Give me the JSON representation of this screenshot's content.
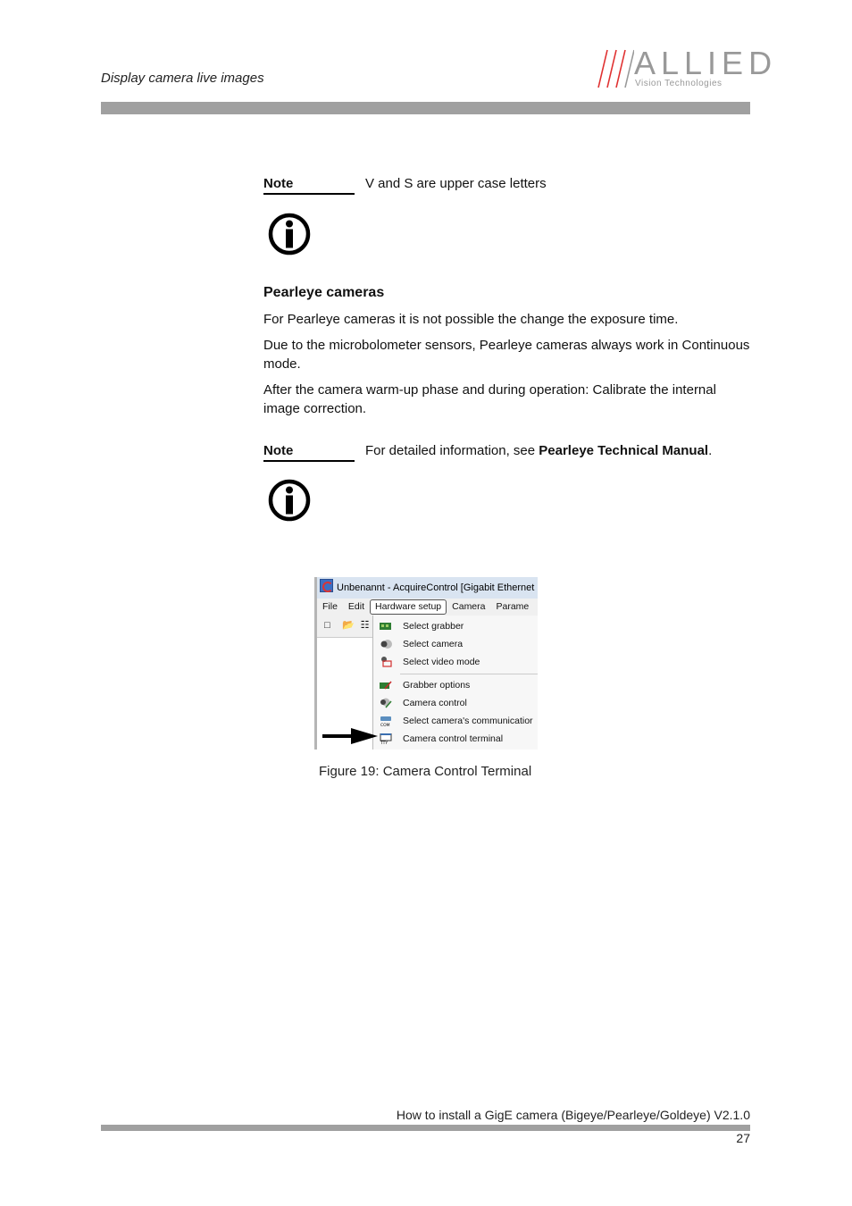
{
  "header": {
    "section_title": "Display camera live images",
    "logo": {
      "word": "ALLIED",
      "subtitle": "Vision Technologies",
      "accent_color": "#e03030",
      "text_color": "#999999"
    }
  },
  "notes": [
    {
      "label": "Note",
      "text": "V and S are upper case letters",
      "icon": "info-icon"
    },
    {
      "label": "Note",
      "text_prefix": "For detailed information, see ",
      "text_bold": "Pearleye Technical Manual",
      "text_suffix": ".",
      "icon": "info-icon"
    }
  ],
  "section": {
    "heading": "Pearleye cameras",
    "paragraphs": [
      "For Pearleye cameras it is not possible the change the exposure time.",
      "Due to the microbolometer sensors, Pearleye cameras always work in Continuous mode.",
      "After the camera warm-up phase and during operation: Calibrate the internal image correction."
    ]
  },
  "figure": {
    "window_title": "Unbenannt - AcquireControl [Gigabit Ethernet",
    "menu": [
      "File",
      "Edit",
      "Hardware setup",
      "Camera",
      "Parame"
    ],
    "active_menu": "Hardware setup",
    "dropdown_items": [
      {
        "label": "Select grabber",
        "icon": "grabber-icon"
      },
      {
        "label": "Select camera",
        "icon": "camera-icon"
      },
      {
        "label": "Select video mode",
        "icon": "video-mode-icon"
      },
      {
        "label": "Grabber options",
        "icon": "grabber-options-icon"
      },
      {
        "label": "Camera control",
        "icon": "camera-control-icon"
      },
      {
        "label": "Select camera's communicatior",
        "icon": "com-port-icon"
      },
      {
        "label": "Camera control terminal",
        "icon": "terminal-icon",
        "highlighted_by_arrow": true
      }
    ],
    "caption": "Figure 19: Camera Control Terminal"
  },
  "footer": {
    "document_title": "How to install a GigE camera (Bigeye/Pearleye/Goldeye) V2.1.0",
    "page_number": "27"
  }
}
